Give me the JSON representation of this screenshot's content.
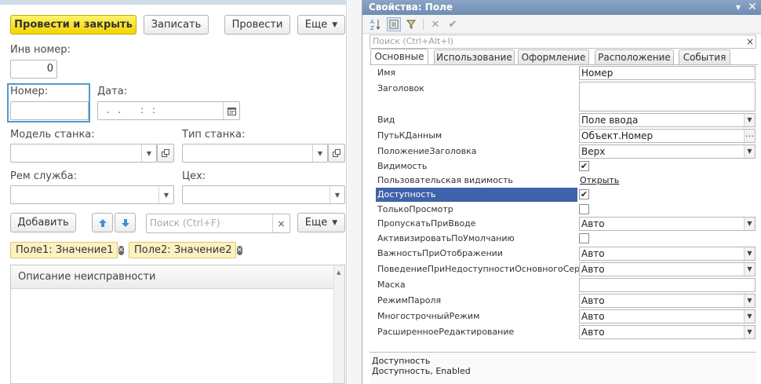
{
  "form": {
    "buttons": {
      "post_close": "Провести и закрыть",
      "write": "Записать",
      "post": "Провести",
      "more": "Еще"
    },
    "inv_number": {
      "label": "Инв номер:",
      "value": "0"
    },
    "number": {
      "label": "Номер:",
      "value": ""
    },
    "date": {
      "label": "Дата:",
      "value": " .  .     :  :  "
    },
    "machine_model": {
      "label": "Модель станка:",
      "value": ""
    },
    "machine_type": {
      "label": "Тип станка:",
      "value": ""
    },
    "repair_service": {
      "label": "Рем служба:",
      "value": ""
    },
    "workshop": {
      "label": "Цех:",
      "value": ""
    },
    "table_toolbar": {
      "add": "Добавить",
      "search_placeholder": "Поиск (Ctrl+F)",
      "more": "Еще"
    },
    "filters": [
      "Поле1: Значение1",
      "Поле2: Значение2"
    ],
    "table": {
      "column": "Описание неисправности"
    }
  },
  "properties": {
    "title": "Свойства: Поле",
    "search_placeholder": "Поиск (Ctrl+Alt+I)",
    "tabs": [
      "Основные",
      "Использование",
      "Оформление",
      "Расположение",
      "События"
    ],
    "active_tab": "Основные",
    "rows": [
      {
        "name": "Имя",
        "type": "text",
        "value": "Номер"
      },
      {
        "name": "Заголовок",
        "type": "textarea",
        "value": ""
      },
      {
        "name": "Вид",
        "type": "select",
        "value": "Поле ввода"
      },
      {
        "name": "ПутьКДанным",
        "type": "picker",
        "value": "Объект.Номер"
      },
      {
        "name": "ПоложениеЗаголовка",
        "type": "select",
        "value": "Верх"
      },
      {
        "name": "Видимость",
        "type": "check",
        "checked": true
      },
      {
        "name": "Пользовательская видимость",
        "type": "link",
        "value": "Открыть"
      },
      {
        "name": "Доступность",
        "type": "check",
        "checked": true,
        "selected": true
      },
      {
        "name": "ТолькоПросмотр",
        "type": "check",
        "checked": false
      },
      {
        "name": "ПропускатьПриВводе",
        "type": "select",
        "value": "Авто"
      },
      {
        "name": "АктивизироватьПоУмолчанию",
        "type": "check",
        "checked": false
      },
      {
        "name": "ВажностьПриОтображении",
        "type": "select",
        "value": "Авто"
      },
      {
        "name": "ПоведениеПриНедоступностиОсновногоСервера",
        "type": "select",
        "value": "Авто"
      },
      {
        "name": "Маска",
        "type": "text",
        "value": ""
      },
      {
        "name": "РежимПароля",
        "type": "select",
        "value": "Авто"
      },
      {
        "name": "МногострочныйРежим",
        "type": "select",
        "value": "Авто"
      },
      {
        "name": "РасширенноеРедактирование",
        "type": "select",
        "value": "Авто"
      }
    ],
    "description": {
      "line1": "Доступность",
      "line2": "Доступность, Enabled"
    }
  }
}
